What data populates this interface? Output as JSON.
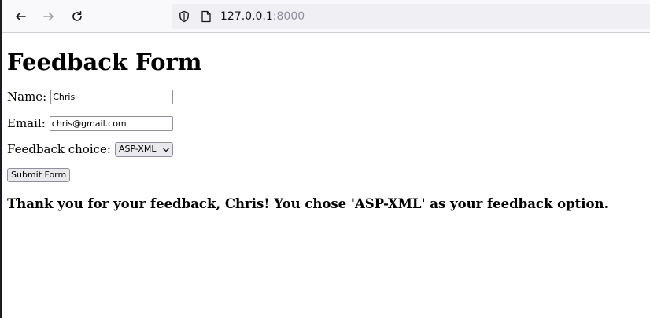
{
  "browser": {
    "url_host": "127.0.0.1",
    "url_port": ":8000",
    "icons": {
      "back": "arrow-left-icon",
      "forward": "arrow-right-icon",
      "reload": "reload-icon",
      "site_info": "shield-icon",
      "page": "page-icon"
    }
  },
  "page": {
    "title": "Feedback Form",
    "name_label": "Name:",
    "name_value": "Chris",
    "email_label": "Email:",
    "email_value": "chris@gmail.com",
    "choice_label": "Feedback choice:",
    "choice_selected": "ASP-XML",
    "submit_label": "Submit Form",
    "thanks_message": "Thank you for your feedback, Chris! You chose 'ASP-XML' as your feedback option."
  },
  "colors": {
    "toolbar_bg": "#f9f9fb",
    "urlbar_bg": "#f0f0f4",
    "control_bg": "#e9e9ed"
  }
}
